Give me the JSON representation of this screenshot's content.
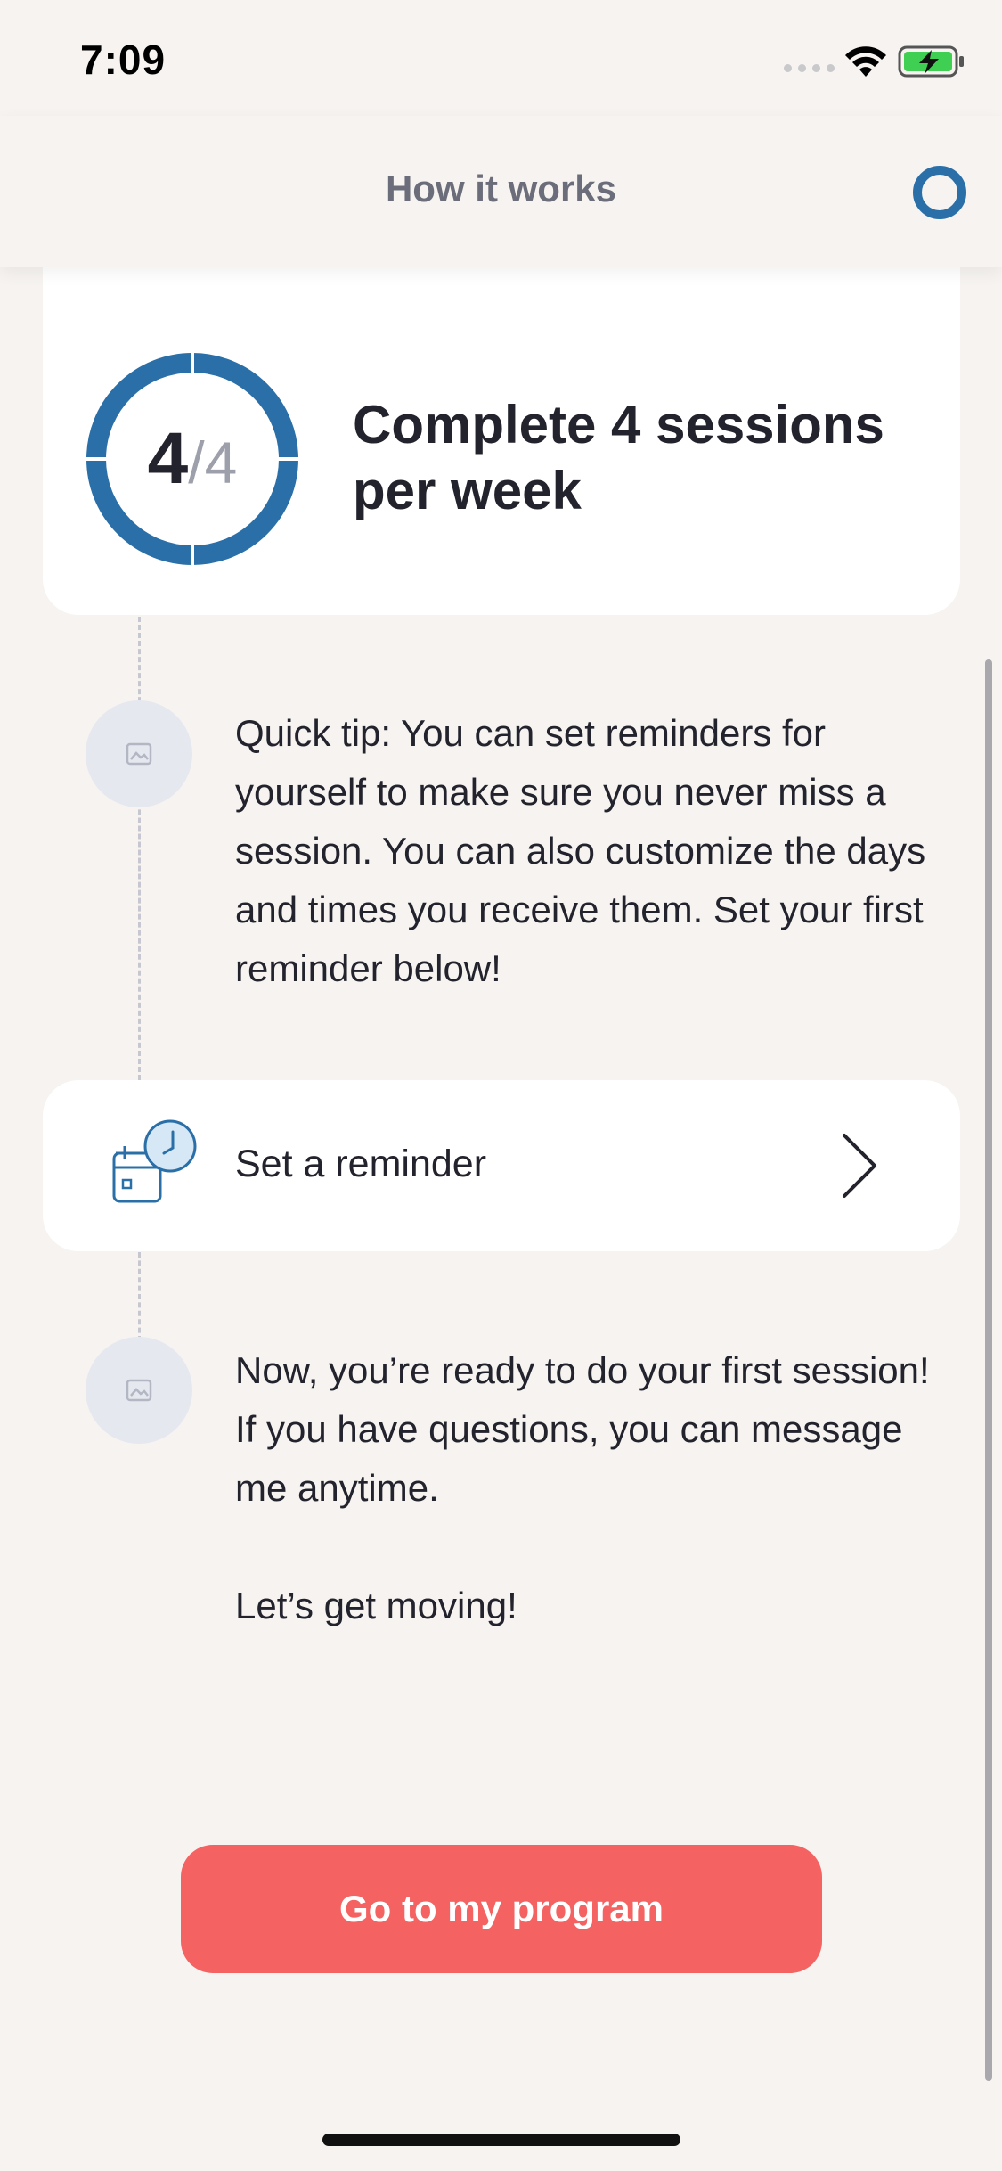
{
  "status_bar": {
    "time": "7:09"
  },
  "nav": {
    "title": "How it works",
    "progress_icon": "progress-ring-icon"
  },
  "goal_card": {
    "completed": "4",
    "total_sep": "/4",
    "progress_fraction": 1.0,
    "title": "Complete 4 sessions per week"
  },
  "tip": {
    "text": "Quick tip: You can set reminders for yourself to make sure you never miss a session. You can also customize the days and times you receive them. Set your first reminder below!"
  },
  "reminder_card": {
    "label": "Set a reminder",
    "icon": "calendar-clock-icon",
    "chevron": "chevron-right-icon"
  },
  "ready": {
    "line1": "Now, you’re ready to do your first session! If you have questions, you can message me anytime.",
    "line2": "Let’s get moving!"
  },
  "cta": {
    "label": "Go to my program"
  },
  "colors": {
    "accent_blue": "#2a6fa8",
    "cta_red": "#f46262",
    "background": "#f6f3f0"
  }
}
